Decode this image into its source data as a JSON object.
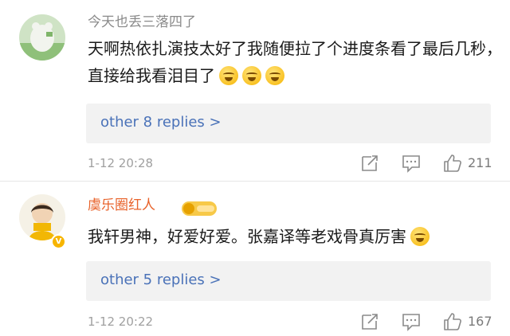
{
  "comments": [
    {
      "username": "今天也丢三落四了",
      "text": "天啊热依扎演技太好了我随便拉了个进度条看了最后几秒，直接给我看泪目了",
      "emojis": [
        "laugh-cry-emoji",
        "laugh-cry-emoji",
        "laugh-cry-emoji"
      ],
      "replies_label": "other 8 replies >",
      "time": "1-12 20:28",
      "likes": "211"
    },
    {
      "username": "虞乐圈红人",
      "text": "我轩男神，好爱好爱。张嘉译等老戏骨真厉害",
      "emojis": [
        "crying-emoji"
      ],
      "replies_label": "other 5 replies >",
      "time": "1-12 20:22",
      "likes": "167",
      "verified_badge": "V"
    }
  ],
  "colors": {
    "link": "#4a72b8",
    "username_vip": "#e8622a",
    "muted": "#a0a0a0"
  }
}
